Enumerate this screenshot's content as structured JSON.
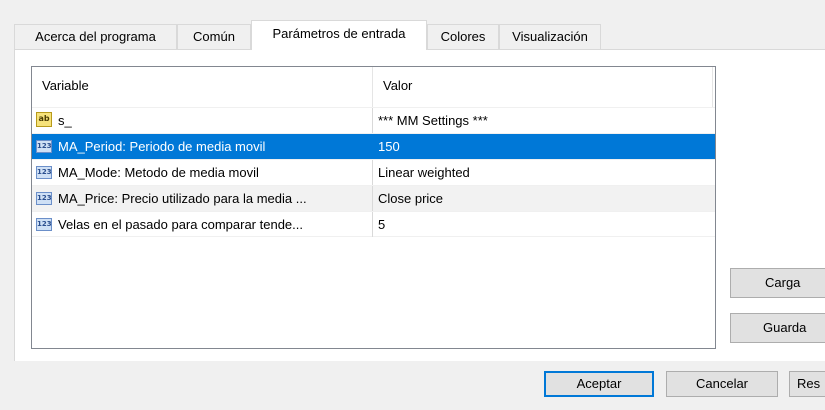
{
  "tabs": [
    {
      "label": "Acerca del programa"
    },
    {
      "label": "Común"
    },
    {
      "label": "Parámetros de entrada",
      "active": true
    },
    {
      "label": "Colores"
    },
    {
      "label": "Visualización"
    }
  ],
  "grid": {
    "columns": {
      "variable": "Variable",
      "value": "Valor"
    },
    "rows": [
      {
        "icon": "string-type-icon",
        "icon_text": "ab",
        "name": "s_",
        "value": "*** MM Settings ***"
      },
      {
        "icon": "number-type-icon",
        "icon_text": "123",
        "name": "MA_Period: Periodo de media movil",
        "value": "150",
        "selected": true
      },
      {
        "icon": "number-type-icon",
        "icon_text": "123",
        "name": "MA_Mode: Metodo de media movil",
        "value": "Linear weighted"
      },
      {
        "icon": "number-type-icon",
        "icon_text": "123",
        "name": "MA_Price: Precio utilizado para la media ...",
        "value": "Close price"
      },
      {
        "icon": "number-type-icon",
        "icon_text": "123",
        "name": "Velas en el pasado para comparar tende...",
        "value": "5"
      }
    ]
  },
  "side_buttons": {
    "load": "Carga",
    "save": "Guarda"
  },
  "footer": {
    "ok": "Aceptar",
    "cancel": "Cancelar",
    "reset": "Res"
  },
  "colors": {
    "selection": "#0078d7",
    "default_button_border": "#0078d7"
  }
}
